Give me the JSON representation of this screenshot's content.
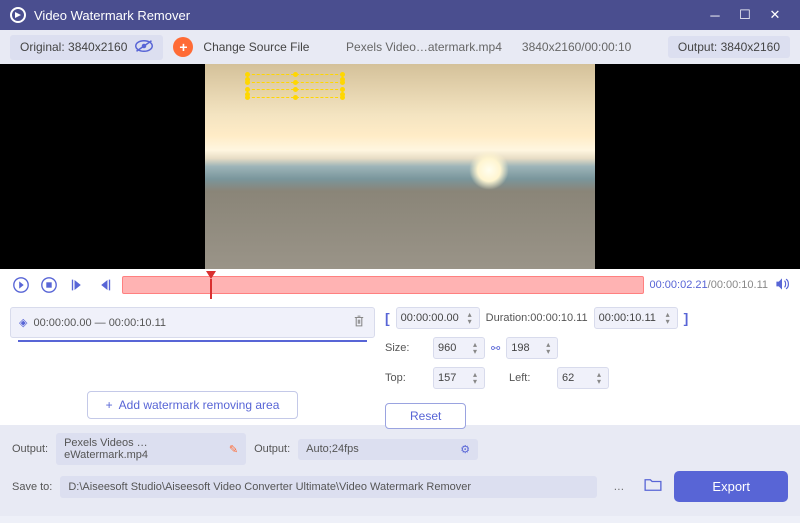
{
  "titlebar": {
    "title": "Video Watermark Remover"
  },
  "toolbar": {
    "original_label": "Original: 3840x2160",
    "change_source": "Change Source File",
    "filename": "Pexels Video…atermark.mp4",
    "meta": "3840x2160/00:00:10",
    "output_label": "Output: 3840x2160"
  },
  "timeline": {
    "current": "00:00:02.21",
    "total": "/00:00:10.11"
  },
  "area": {
    "range": "00:00:00.00 — 00:00:10.11",
    "add_label": "Add watermark removing area"
  },
  "clip": {
    "start": "00:00:00.00",
    "duration_label": "Duration:00:00:10.11",
    "end": "00:00:10.11",
    "size_label": "Size:",
    "width": "960",
    "height": "198",
    "top_label": "Top:",
    "top": "157",
    "left_label": "Left:",
    "left": "62",
    "reset": "Reset"
  },
  "output": {
    "label": "Output:",
    "filename": "Pexels Videos …eWatermark.mp4",
    "format_label": "Output:",
    "format": "Auto;24fps",
    "save_label": "Save to:",
    "path": "D:\\Aiseesoft Studio\\Aiseesoft Video Converter Ultimate\\Video Watermark Remover",
    "export": "Export"
  }
}
